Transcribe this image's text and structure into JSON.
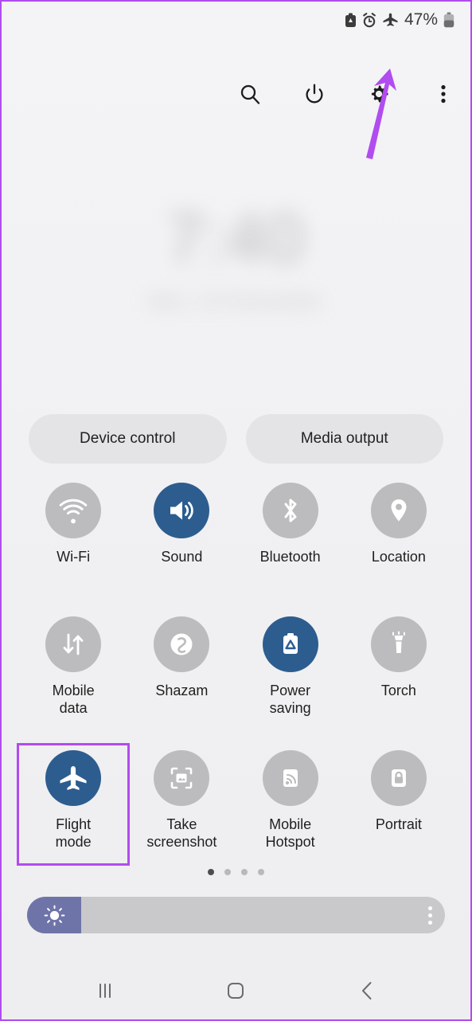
{
  "theme": {
    "accent_active": "#2d5d8f",
    "accent_inactive": "#bcbcbe",
    "annotation": "#b14cf0",
    "panel_bg": "#f1f1f3",
    "slider_fill": "#6f74a8",
    "slider_track": "#c9c9cb"
  },
  "status_bar": {
    "icons": [
      "power-saving-icon",
      "alarm-icon",
      "airplane-icon"
    ],
    "battery_percent": "47%",
    "battery_icon": "battery-icon"
  },
  "toolbar": {
    "buttons": [
      {
        "name": "search-button",
        "icon": "search-icon"
      },
      {
        "name": "power-button",
        "icon": "power-icon"
      },
      {
        "name": "settings-button",
        "icon": "gear-icon"
      },
      {
        "name": "more-options-button",
        "icon": "three-dot-menu-icon"
      }
    ]
  },
  "clock": {
    "time": "7:40",
    "date": "Mon, 23 November"
  },
  "pills": {
    "device_control": "Device control",
    "media_output": "Media output"
  },
  "toggles": [
    {
      "label": "Wi-Fi",
      "icon": "wifi-icon",
      "state": "off",
      "name": "toggle-wifi"
    },
    {
      "label": "Sound",
      "icon": "sound-icon",
      "state": "on",
      "name": "toggle-sound"
    },
    {
      "label": "Bluetooth",
      "icon": "bluetooth-icon",
      "state": "off",
      "name": "toggle-bluetooth"
    },
    {
      "label": "Location",
      "icon": "location-pin-icon",
      "state": "off",
      "name": "toggle-location"
    },
    {
      "label": "Mobile\ndata",
      "icon": "mobile-data-icon",
      "state": "off",
      "name": "toggle-mobile-data"
    },
    {
      "label": "Shazam",
      "icon": "shazam-icon",
      "state": "off",
      "name": "toggle-shazam"
    },
    {
      "label": "Power\nsaving",
      "icon": "power-saving-icon",
      "state": "on",
      "name": "toggle-power-saving"
    },
    {
      "label": "Torch",
      "icon": "torch-icon",
      "state": "off",
      "name": "toggle-torch"
    },
    {
      "label": "Flight\nmode",
      "icon": "airplane-icon",
      "state": "on",
      "name": "toggle-flight-mode",
      "highlighted": true
    },
    {
      "label": "Take\nscreenshot",
      "icon": "screenshot-icon",
      "state": "off",
      "name": "toggle-take-screenshot"
    },
    {
      "label": "Mobile\nHotspot",
      "icon": "hotspot-icon",
      "state": "off",
      "name": "toggle-mobile-hotspot"
    },
    {
      "label": "Portrait",
      "icon": "rotation-lock-icon",
      "state": "off",
      "name": "toggle-portrait"
    }
  ],
  "page_indicator": {
    "total": 4,
    "active_index": 0
  },
  "brightness": {
    "icon": "brightness-sun-icon",
    "value_percent": 13,
    "menu_icon": "three-dot-menu-icon"
  },
  "nav_bar": {
    "recents": "recents-icon",
    "home": "home-icon",
    "back": "back-icon"
  },
  "annotation": {
    "type": "arrow",
    "points_to": "airplane-icon-in-status-bar",
    "color": "#b14cf0"
  }
}
